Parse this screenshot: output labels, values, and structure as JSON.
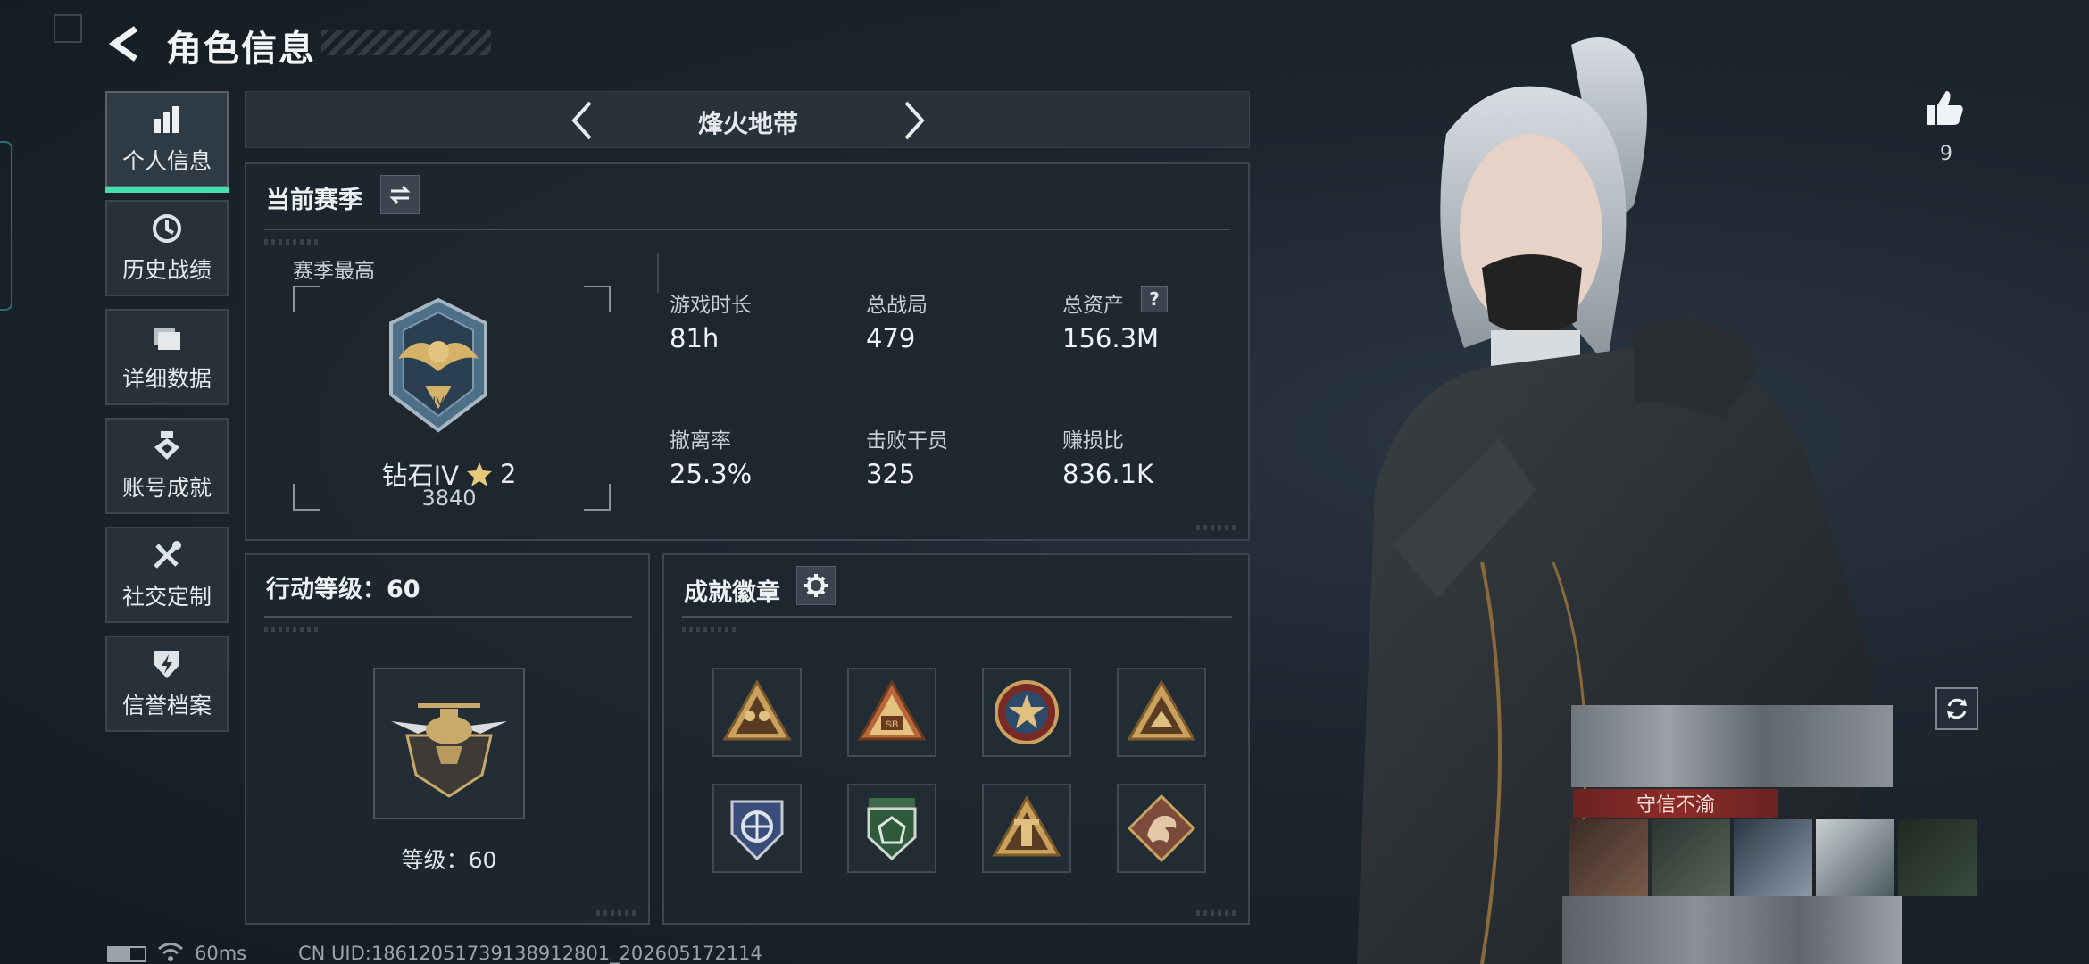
{
  "header": {
    "title": "角色信息"
  },
  "sidebar": {
    "items": [
      {
        "label": "个人信息",
        "icon": "bar-chart-icon",
        "active": true
      },
      {
        "label": "历史战绩",
        "icon": "clock-history-icon",
        "active": false
      },
      {
        "label": "详细数据",
        "icon": "folder-icon",
        "active": false
      },
      {
        "label": "账号成就",
        "icon": "medal-icon",
        "active": false
      },
      {
        "label": "社交定制",
        "icon": "wrench-tools-icon",
        "active": false
      },
      {
        "label": "信誉档案",
        "icon": "shield-lightning-icon",
        "active": false
      }
    ]
  },
  "mode_banner": {
    "title": "烽火地带"
  },
  "season": {
    "title": "当前赛季",
    "best_label": "赛季最高",
    "rank_name": "钻石IV",
    "stars": "2",
    "score": "3840",
    "stats": [
      {
        "label": "游戏时长",
        "value": "81h"
      },
      {
        "label": "总战局",
        "value": "479"
      },
      {
        "label": "总资产",
        "value": "156.3M",
        "help": "?"
      },
      {
        "label": "撤离率",
        "value": "25.3%"
      },
      {
        "label": "击败干员",
        "value": "325"
      },
      {
        "label": "赚损比",
        "value": "836.1K"
      }
    ]
  },
  "action_level": {
    "title": "行动等级：60",
    "level_text": "等级：60"
  },
  "achievements": {
    "title": "成就徽章",
    "badges": [
      "triangle-soldiers-badge",
      "triangle-sb-badge",
      "star-emblem-badge",
      "triangle-hands-badge",
      "shield-blue-badge",
      "shield-green-badge",
      "triangle-tower-badge",
      "dragon-badge"
    ]
  },
  "status_bar": {
    "ping": "60ms",
    "uid": "CN UID:1861205173913891280‍1_202605172114"
  },
  "right": {
    "likes": "9",
    "honor_title": "守信不渝"
  },
  "colors": {
    "accent": "#43e0ae",
    "panel": "#1e272f",
    "honor": "#8c2b28"
  }
}
